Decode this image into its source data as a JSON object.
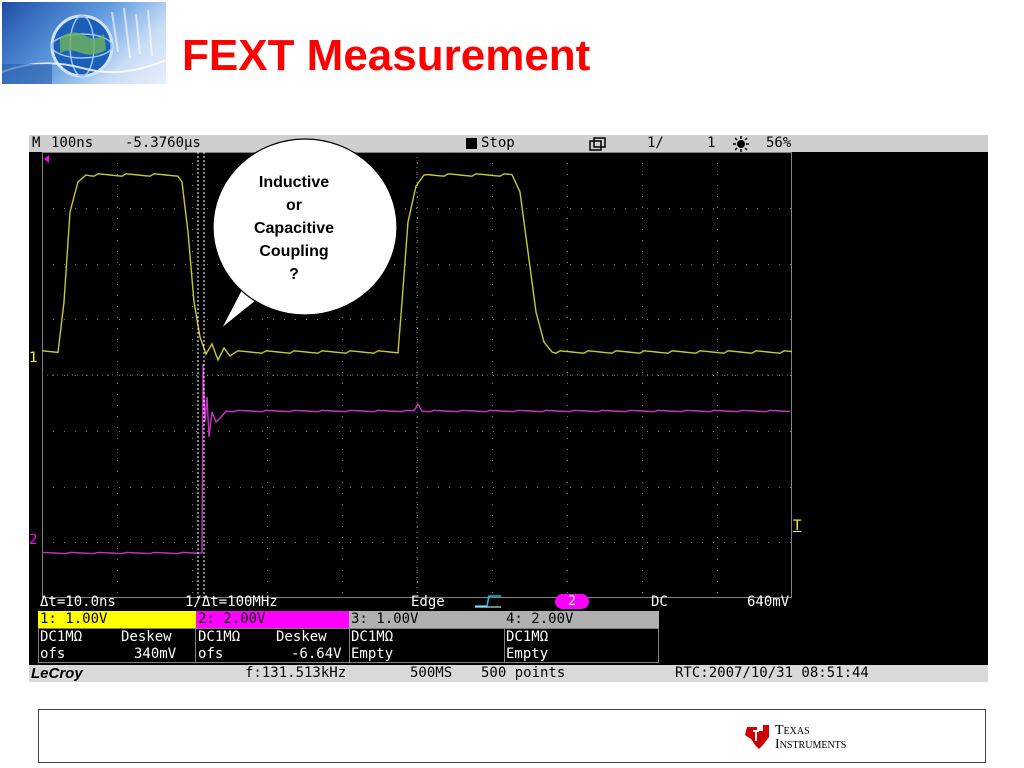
{
  "slide": {
    "title": "FEXT Measurement"
  },
  "scope": {
    "topbar": {
      "timebase_label": "M",
      "timebase": "100ns",
      "delay": "-5.3760µs",
      "run_state": "Stop",
      "frame_icon": "overlay-frames-icon",
      "frame_counter": "1/",
      "frame_total": "1",
      "brightness_icon": "sun-icon",
      "brightness": "56%"
    },
    "markers": {
      "ch1": "1",
      "ch2": "2",
      "trigger": "T"
    },
    "cursor_readout": {
      "delta_t": "Δt=10.0ns",
      "inverse_delta_t": "1/Δt=100MHz",
      "trigger_type": "Edge",
      "trigger_source": "2",
      "coupling": "DC",
      "level": "640mV"
    },
    "channels": [
      {
        "label": "1: 1.00V",
        "coupling": "DC1MΩ",
        "deskew": "Deskew",
        "ofs_label": "ofs",
        "ofs": "340mV"
      },
      {
        "label": "2: 2.00V",
        "coupling": "DC1MΩ",
        "deskew": "Deskew",
        "ofs_label": "ofs",
        "ofs": "-6.64V"
      },
      {
        "label": "3: 1.00V",
        "coupling": "DC1MΩ",
        "status": "Empty"
      },
      {
        "label": "4: 2.00V",
        "coupling": "DC1MΩ",
        "status": "Empty"
      }
    ],
    "bottombar": {
      "brand": "LeCroy",
      "frequency": "f:131.513kHz",
      "sample_rate": "500MS",
      "points": "500 points",
      "rtc": "RTC:2007/10/31 08:51:44"
    },
    "colors": {
      "ch1": "#c8c832",
      "ch2": "#c832c8",
      "grid": "#808080",
      "ch1_bg": "#ffff00",
      "ch2_bg": "#ff00ff"
    }
  },
  "annotation": {
    "line1": "Inductive",
    "line2": "or",
    "line3": "Capacitive",
    "line4": "Coupling",
    "line5": "?"
  },
  "footer": {
    "brand_line1": "Texas",
    "brand_line2": "Instruments",
    "logo_icon": "ti-logo-icon"
  }
}
